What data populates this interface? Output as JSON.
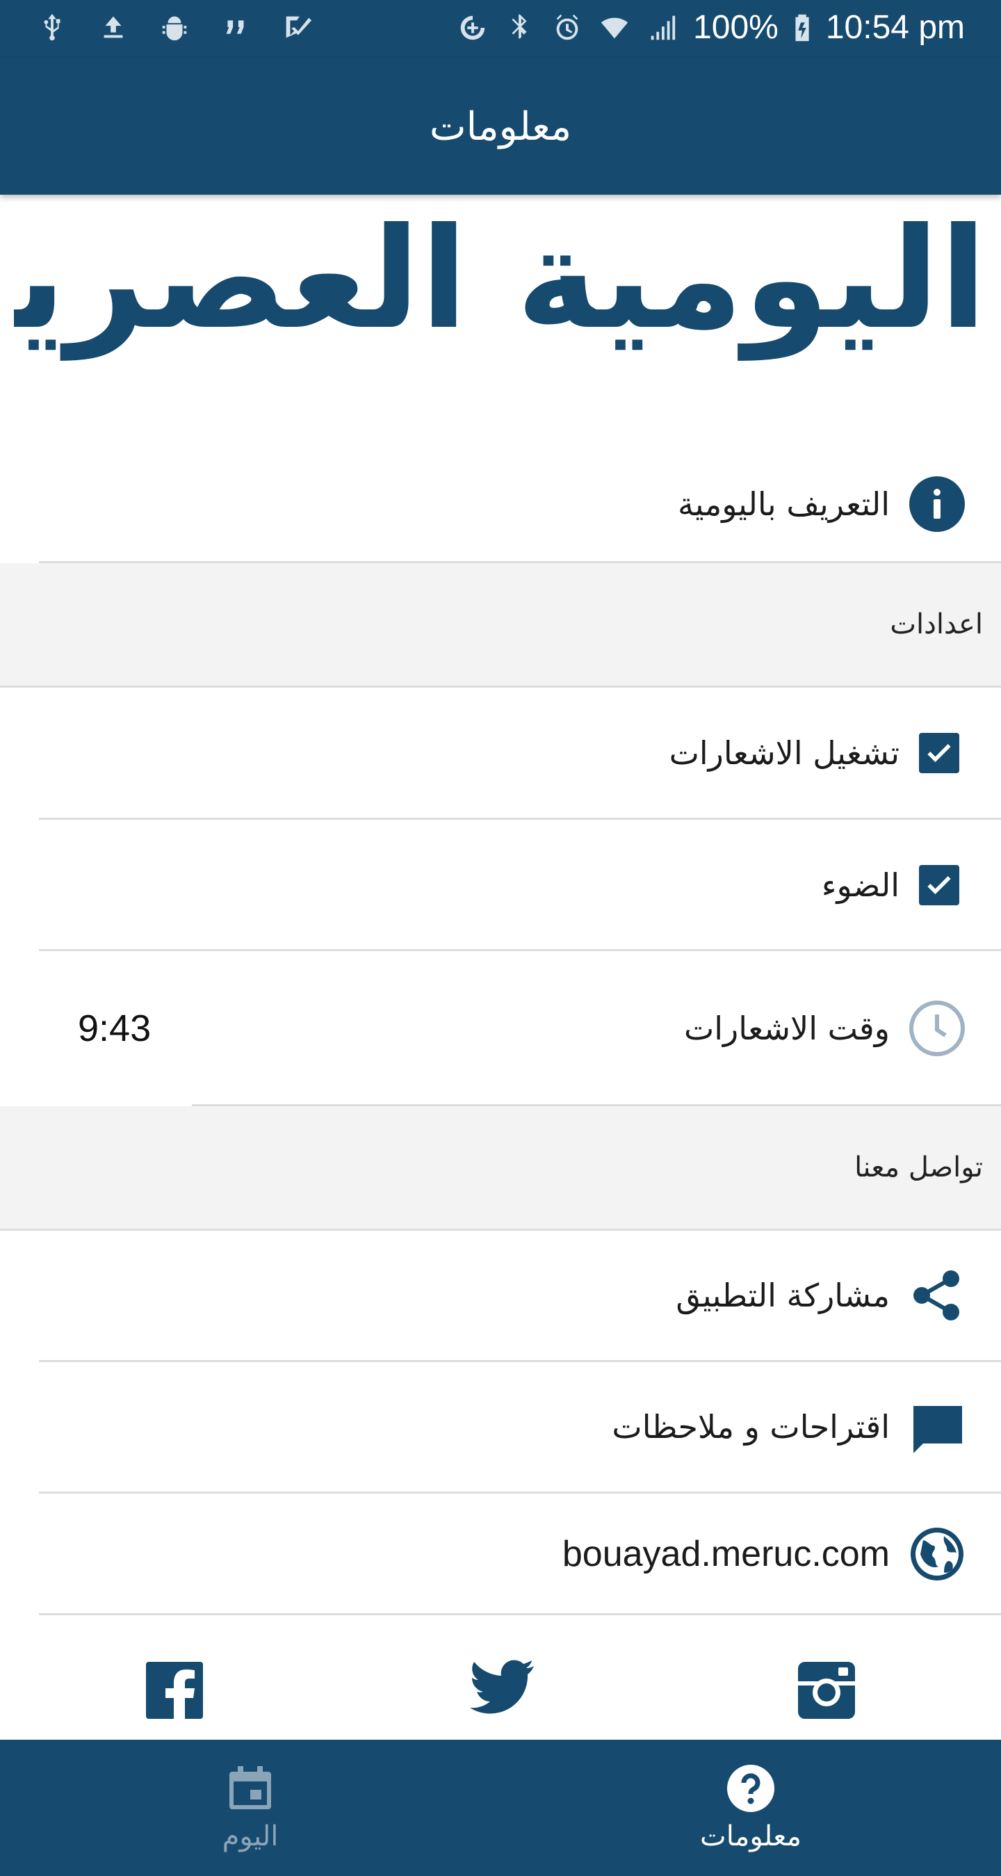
{
  "status_bar": {
    "battery": "100%",
    "time": "10:54 pm"
  },
  "app_bar": {
    "title": "معلومات"
  },
  "logo": {
    "text": "اليومية العصرية"
  },
  "about": {
    "label": "التعريف باليومية"
  },
  "settings_section": {
    "title": "اعدادات"
  },
  "settings": {
    "notifications_label": "تشغيل الاشعارات",
    "light_label": "الضوء",
    "notification_time_label": "وقت الاشعارات",
    "notification_time_value": "9:43"
  },
  "contact_section": {
    "title": "تواصل معنا"
  },
  "contact": {
    "share_label": "مشاركة التطبيق",
    "feedback_label": "اقتراحات و ملاحظات",
    "website_label": "bouayad.meruc.com"
  },
  "bottom_nav": {
    "today_label": "اليوم",
    "info_label": "معلومات"
  },
  "colors": {
    "primary": "#164a6e",
    "section_bg": "#f3f3f3",
    "divider": "#dddddd",
    "clock_icon": "#9fb3c4",
    "inactive_nav": "#8aa4b8"
  },
  "icons": {
    "about": "info-circle-icon",
    "notification_time": "clock-icon",
    "share": "share-icon",
    "feedback": "message-icon",
    "website": "globe-icon",
    "facebook": "facebook-icon",
    "twitter": "twitter-icon",
    "instagram": "instagram-icon",
    "today": "calendar-icon",
    "info": "help-circle-icon"
  }
}
